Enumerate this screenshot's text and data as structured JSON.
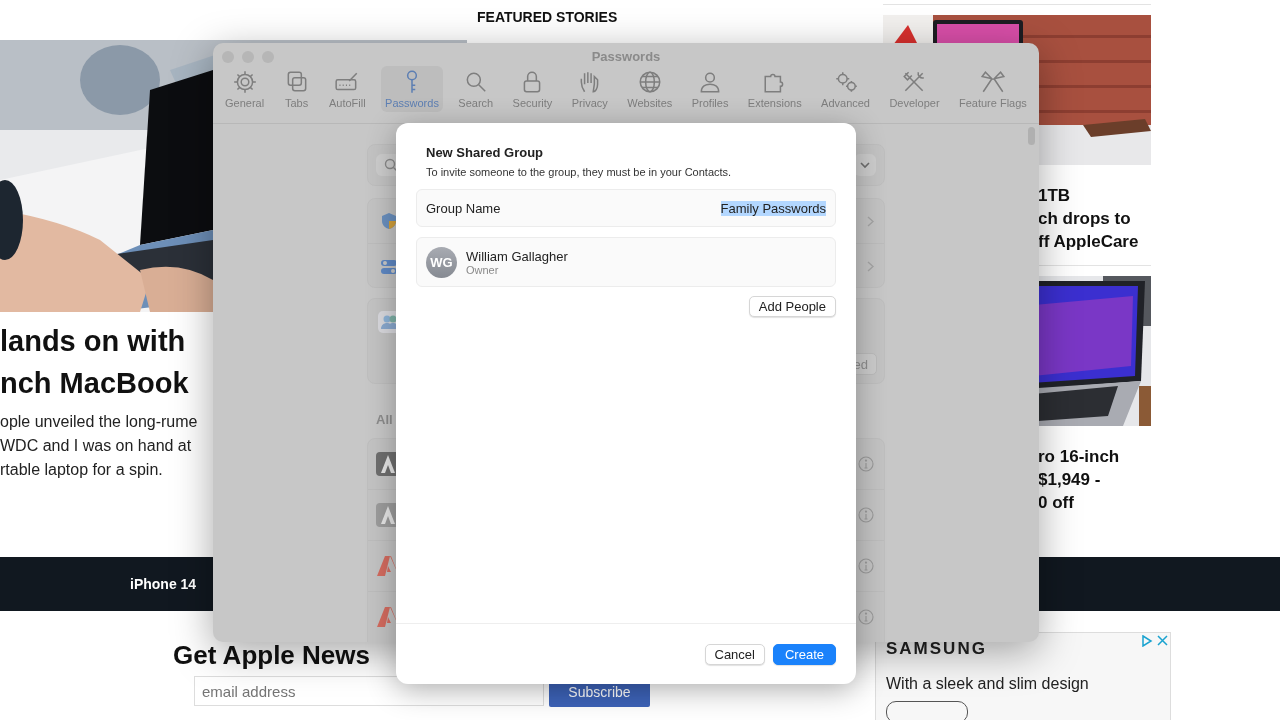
{
  "web_page": {
    "section_heading": "FEATURED STORIES",
    "main_story": {
      "headline": [
        "lands on with",
        "nch MacBook"
      ],
      "summary": [
        "ople unveiled the long-rume",
        "WDC and I was on hand at",
        "rtable laptop for a spin."
      ]
    },
    "side_stories": [
      {
        "title": [
          "1TB",
          "ch drops to",
          "ff AppleCare"
        ]
      },
      {
        "title": [
          "ro 16-inch",
          "$1,949 -",
          "0 off"
        ]
      }
    ],
    "nav_bar": {
      "items": [
        "iPhone 14"
      ]
    },
    "newsletter": {
      "heading": "Get Apple News",
      "email_placeholder": "email address",
      "button": "Subscribe"
    },
    "ad": {
      "brand": "SAMSUNG",
      "text": "With a sleek and slim design"
    }
  },
  "settings_window": {
    "title": "Passwords",
    "toolbar": [
      {
        "label": "General",
        "selected": false
      },
      {
        "label": "Tabs",
        "selected": false
      },
      {
        "label": "AutoFill",
        "selected": false
      },
      {
        "label": "Passwords",
        "selected": true
      },
      {
        "label": "Search",
        "selected": false
      },
      {
        "label": "Security",
        "selected": false
      },
      {
        "label": "Privacy",
        "selected": false
      },
      {
        "label": "Websites",
        "selected": false
      },
      {
        "label": "Profiles",
        "selected": false
      },
      {
        "label": "Extensions",
        "selected": false
      },
      {
        "label": "Advanced",
        "selected": false
      },
      {
        "label": "Developer",
        "selected": false
      },
      {
        "label": "Feature Flags",
        "selected": false
      }
    ],
    "partial_button": "ed",
    "list_heading": "All"
  },
  "dialog": {
    "title": "New Shared Group",
    "subtitle": "To invite someone to the group, they must be in your Contacts.",
    "group_name": {
      "label": "Group Name",
      "value": "Family Passwords",
      "value_selected": true
    },
    "members": [
      {
        "initials": "WG",
        "name": "William Gallagher",
        "role": "Owner"
      }
    ],
    "add_button": "Add People",
    "buttons": [
      {
        "label": "Cancel",
        "kind": "secondary"
      },
      {
        "label": "Create",
        "kind": "primary"
      }
    ]
  }
}
